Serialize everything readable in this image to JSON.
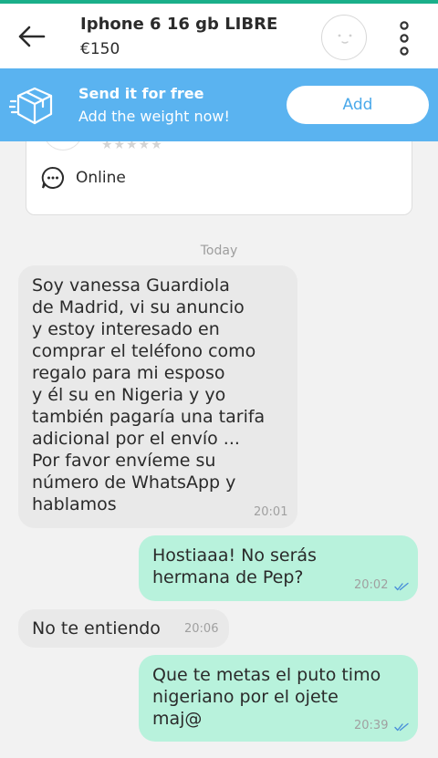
{
  "header": {
    "title": "Iphone 6 16 gb LIBRE",
    "price": "€150"
  },
  "banner": {
    "title": "Send it for free",
    "subtitle": "Add the weight now!",
    "button_label": "Add"
  },
  "seller_card": {
    "status": "Online",
    "rating_stars": "★★★★★"
  },
  "chat": {
    "date_label": "Today",
    "messages": [
      {
        "direction": "incoming",
        "text": "Soy vanessa Guardiola\nde Madrid, vi su anuncio\ny estoy interesado en\ncomprar el teléfono como\nregalo para mi esposo\ny él su en Nigeria y yo\ntambién pagaría una tarifa\nadicional por el envío ...\nPor favor envíeme su\nnúmero de WhatsApp y\nhablamos",
        "time": "20:01"
      },
      {
        "direction": "outgoing",
        "text": "Hostiaaa! No serás\nhermana de Pep?",
        "time": "20:02",
        "read": true
      },
      {
        "direction": "incoming",
        "text": "No te entiendo",
        "time": "20:06"
      },
      {
        "direction": "outgoing",
        "text": "Que te metas el puto timo\nnigeriano por el ojete\nmaj@",
        "time": "20:39",
        "read": true
      }
    ]
  },
  "colors": {
    "accent_green": "#1aaf8a",
    "banner_blue": "#5ab3f0",
    "outgoing_bubble": "#b8f2dc",
    "incoming_bubble": "#e9e9e9",
    "read_ticks": "#4a90d9"
  },
  "icons": {
    "back": "arrow-left-icon",
    "avatar": "smiley-avatar-icon",
    "menu": "more-vertical-icon",
    "shipping": "box-icon",
    "online": "chat-dots-icon"
  }
}
